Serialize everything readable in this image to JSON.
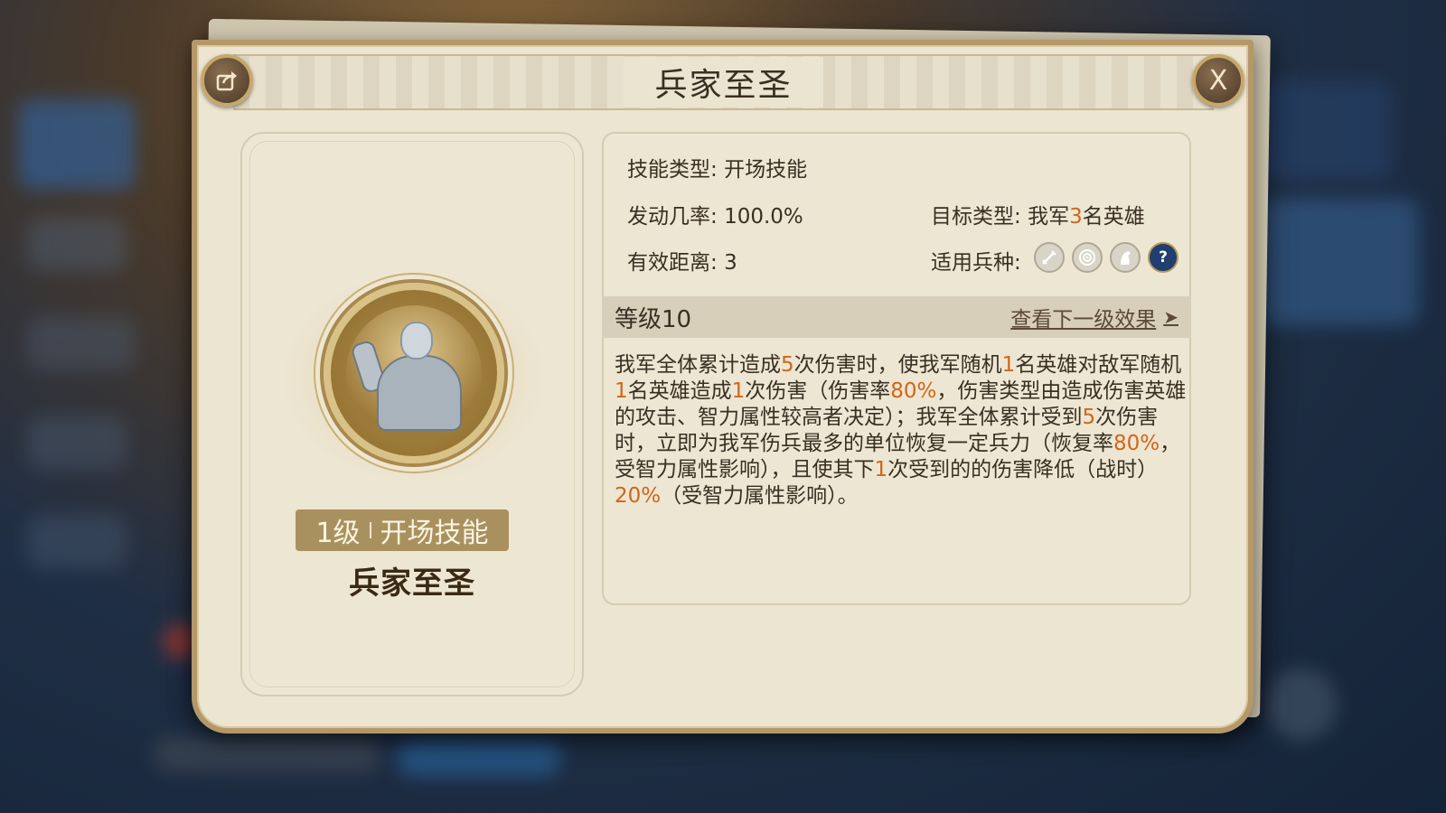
{
  "dialog": {
    "title": "兵家至圣",
    "close_label": "X",
    "share_icon": "share-icon"
  },
  "left_panel": {
    "badge_level": "1级",
    "badge_type": "开场技能",
    "skill_name": "兵家至圣"
  },
  "info": {
    "skill_type_label": "技能类型:",
    "skill_type_value": "开场技能",
    "trigger_label": "发动几率:",
    "trigger_value": "100.0%",
    "range_label": "有效距离:",
    "range_value": "3",
    "target_label": "目标类型:",
    "target_prefix": "我军",
    "target_count": "3",
    "target_suffix": "名英雄",
    "units_label": "适用兵种:",
    "unit_icons": [
      "infantry-sword-icon",
      "archer-target-icon",
      "cavalry-horse-icon",
      "help-question-icon"
    ],
    "help_symbol": "?"
  },
  "level": {
    "label": "等级10",
    "next_link": "查看下一级效果",
    "chevron": "➤"
  },
  "description": {
    "segments": [
      {
        "t": "我军全体累计造成",
        "h": false
      },
      {
        "t": "5",
        "h": true
      },
      {
        "t": "次伤害时，使我军随机",
        "h": false
      },
      {
        "t": "1",
        "h": true
      },
      {
        "t": "名英雄对敌军随机",
        "h": false
      },
      {
        "t": "1",
        "h": true
      },
      {
        "t": "名英雄造成",
        "h": false
      },
      {
        "t": "1",
        "h": true
      },
      {
        "t": "次伤害（伤害率",
        "h": false
      },
      {
        "t": "80%",
        "h": true
      },
      {
        "t": "，伤害类型由造成伤害英雄的攻击、智力属性较高者决定）；我军全体累计受到",
        "h": false
      },
      {
        "t": "5",
        "h": true
      },
      {
        "t": "次伤害时，立即为我军伤兵最多的单位恢复一定兵力（恢复率",
        "h": false
      },
      {
        "t": "80%",
        "h": true
      },
      {
        "t": "，受智力属性影响），且使其下",
        "h": false
      },
      {
        "t": "1",
        "h": true
      },
      {
        "t": "次受到的的伤害降低（战时）",
        "h": false
      },
      {
        "t": "20%",
        "h": true
      },
      {
        "t": "（受智力属性影响）。",
        "h": false
      }
    ]
  },
  "colors": {
    "highlight": "#d0661a",
    "panel_bg": "#ece5d2",
    "frame_gold": "#b49868"
  }
}
